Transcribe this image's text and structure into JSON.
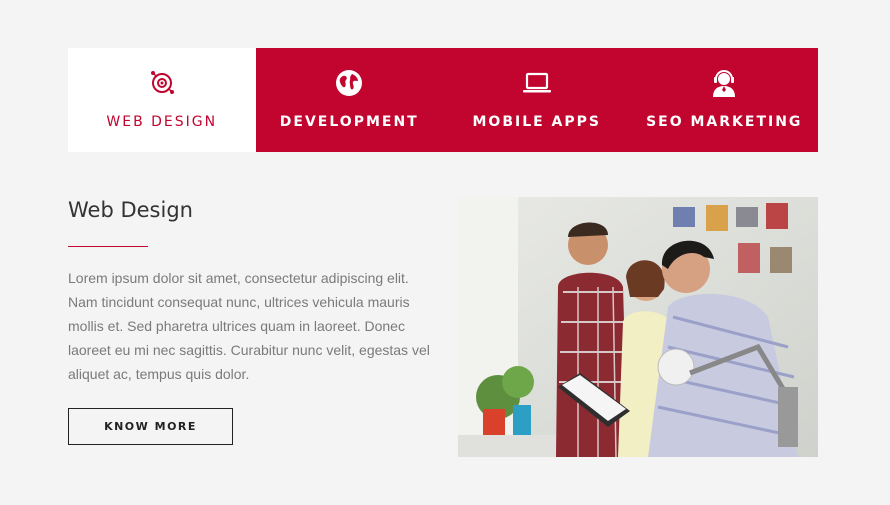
{
  "tabs": [
    {
      "label": "WEB DESIGN",
      "icon": "web-design-icon",
      "active": true
    },
    {
      "label": "DEVELOPMENT",
      "icon": "globe-icon",
      "active": false
    },
    {
      "label": "MOBILE APPS",
      "icon": "laptop-icon",
      "active": false
    },
    {
      "label": "SEO MARKETING",
      "icon": "support-headset-icon",
      "active": false
    }
  ],
  "content": {
    "title": "Web Design",
    "paragraph": "Lorem ipsum dolor sit amet, consectetur adipiscing elit. Nam tincidunt consequat nunc, ultrices vehicula mauris mollis et. Sed pharetra ultrices quam in laoreet. Donec laoreet eu mi nec sagittis. Curabitur nunc velit, egestas vel aliquet ac, tempus quis dolor.",
    "button_label": "KNOW MORE"
  },
  "colors": {
    "accent": "#c1052f",
    "background": "#f4f4f4",
    "tab_active_bg": "#ffffff"
  }
}
